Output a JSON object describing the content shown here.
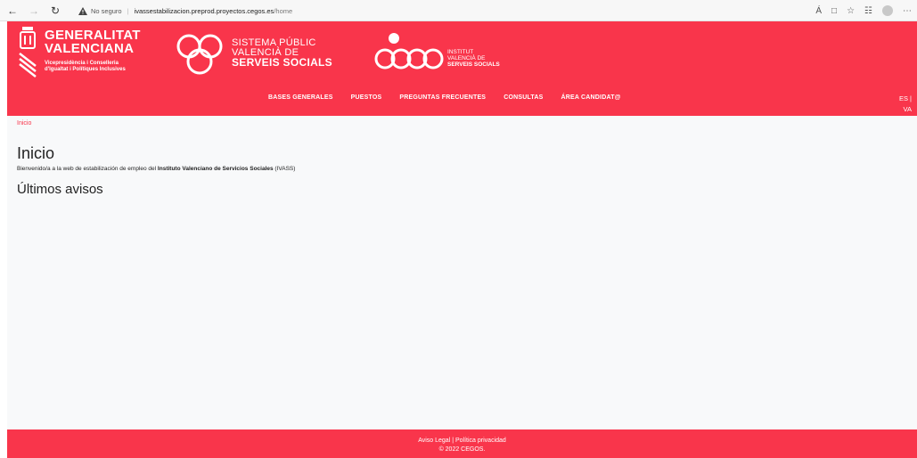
{
  "browser": {
    "security_label": "No seguro",
    "url_host": "ivassestabilizacion.preprod.proyectos.cegos.es",
    "url_path": "/home"
  },
  "header": {
    "gv": {
      "line1": "GENERALITAT",
      "line2": "VALENCIANA",
      "sub1": "Vicepresidència i Conselleria",
      "sub2": "d'Igualtat i Polítiques Inclusives"
    },
    "sps": {
      "line1": "SISTEMA PÚBLIC",
      "line2": "VALENCIÀ DE",
      "line3": "SERVEIS SOCIALS"
    },
    "ivass": {
      "line1": "INSTITUT",
      "line2": "VALENCIÀ DE",
      "line3": "SERVEIS SOCIALS"
    },
    "menu": [
      "BASES GENERALES",
      "PUESTOS",
      "PREGUNTAS FRECUENTES",
      "CONSULTAS",
      "ÁREA CANDIDAT@"
    ],
    "lang_es": "ES",
    "lang_sep": "|",
    "lang_va": "VA"
  },
  "content": {
    "breadcrumb": "Inicio",
    "title": "Inicio",
    "welcome_prefix": "Bienvenido/a a la web de estabilización de empleo del ",
    "welcome_strong": "Instituto Valenciano de Servicios Sociales",
    "welcome_suffix": " (IVASS)",
    "notices_heading": "Últimos avisos"
  },
  "footer": {
    "legal": "Aviso Legal",
    "sep": "|",
    "privacy": "Política privacidad",
    "copyright": "© 2022 CEGOS."
  },
  "colors": {
    "brand_red": "#f9354b"
  }
}
